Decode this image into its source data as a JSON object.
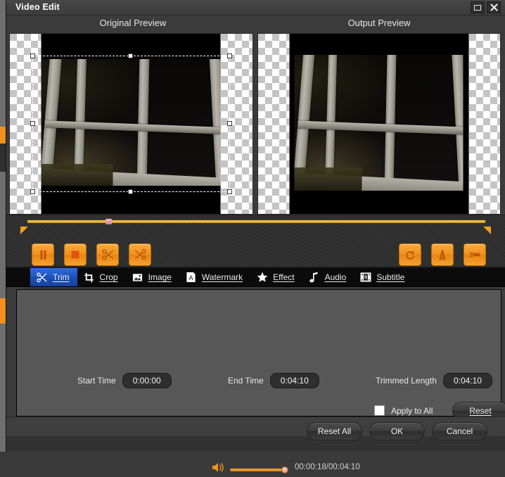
{
  "window": {
    "title": "Video Edit",
    "controls": [
      {
        "name": "maximize-button",
        "glyph": "maximize"
      },
      {
        "name": "close-button",
        "glyph": "X"
      }
    ]
  },
  "previews": {
    "original_label": "Original Preview",
    "output_label": "Output Preview"
  },
  "transport": {
    "buttons_left": [
      {
        "name": "pause-button",
        "icon": "pause-icon"
      },
      {
        "name": "stop-button",
        "icon": "stop-icon"
      },
      {
        "name": "cut-button",
        "icon": "scissors-icon"
      },
      {
        "name": "delete-segment-button",
        "icon": "scissors-delete-icon"
      }
    ],
    "buttons_right": [
      {
        "name": "rotate-button",
        "icon": "rotate-icon"
      },
      {
        "name": "flip-horizontal-button",
        "icon": "flip-horizontal-icon"
      },
      {
        "name": "flip-vertical-button",
        "icon": "flip-vertical-icon"
      }
    ],
    "volume_icon": "speaker-icon",
    "volume_percent": 100,
    "time_display": "00:00:18/00:04:10",
    "current_time": "00:00:18",
    "total_time": "00:04:10",
    "seek_percent": 17
  },
  "tabs": [
    {
      "label": "Trim",
      "accel": "T",
      "icon": "scissors-icon",
      "active": true
    },
    {
      "label": "Crop",
      "accel": "C",
      "icon": "crop-icon",
      "active": false
    },
    {
      "label": "Image",
      "accel": "I",
      "icon": "image-icon",
      "active": false
    },
    {
      "label": "Watermark",
      "accel": "W",
      "icon": "text-a-icon",
      "active": false
    },
    {
      "label": "Effect",
      "accel": "E",
      "icon": "star-icon",
      "active": false
    },
    {
      "label": "Audio",
      "accel": "A",
      "icon": "music-note-icon",
      "active": false
    },
    {
      "label": "Subtitle",
      "accel": "S",
      "icon": "subtitle-icon",
      "active": false
    }
  ],
  "trim_panel": {
    "start_time_label": "Start Time",
    "start_time_value": "0:00:00",
    "end_time_label": "End Time",
    "end_time_value": "0:04:10",
    "trimmed_length_label": "Trimmed Length",
    "trimmed_length_value": "0:04:10",
    "apply_to_all_label": "Apply to All",
    "apply_to_all_checked": false,
    "reset_label": "Reset",
    "reset_accel": "R"
  },
  "footer": {
    "reset_all_label": "Reset All",
    "ok_label": "OK",
    "cancel_label": "Cancel"
  },
  "colors": {
    "accent_orange": "#f0911f",
    "tab_active_blue": "#1c4fb5",
    "timeline_yellow": "#ffd24a",
    "panel_gray": "#575757",
    "window_gray": "#3b3b3b"
  }
}
